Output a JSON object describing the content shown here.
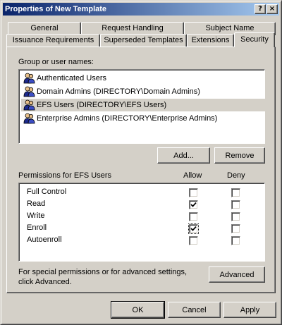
{
  "window": {
    "title": "Properties of New Template",
    "help_button": "?",
    "close_button": "×"
  },
  "tabs_back_row": [
    {
      "label": "General"
    },
    {
      "label": "Request Handling"
    },
    {
      "label": "Subject Name"
    }
  ],
  "tabs_front_row": [
    {
      "label": "Issuance Requirements"
    },
    {
      "label": "Superseded Templates"
    },
    {
      "label": "Extensions"
    },
    {
      "label": "Security",
      "active": true
    }
  ],
  "security": {
    "group_label": "Group or user names:",
    "users": [
      {
        "name": "Authenticated Users",
        "icon": "user-group-icon"
      },
      {
        "name": "Domain Admins (DIRECTORY\\Domain Admins)",
        "icon": "user-group-icon"
      },
      {
        "name": "EFS Users (DIRECTORY\\EFS Users)",
        "icon": "user-group-icon",
        "selected": true
      },
      {
        "name": "Enterprise Admins (DIRECTORY\\Enterprise Admins)",
        "icon": "user-group-icon"
      }
    ],
    "add_button": "Add...",
    "remove_button": "Remove",
    "permissions_label": "Permissions for EFS Users",
    "allow_header": "Allow",
    "deny_header": "Deny",
    "permissions": [
      {
        "name": "Full Control",
        "allow": false,
        "deny": false
      },
      {
        "name": "Read",
        "allow": true,
        "deny": false
      },
      {
        "name": "Write",
        "allow": false,
        "deny": false
      },
      {
        "name": "Enroll",
        "allow": true,
        "deny": false,
        "focused": true
      },
      {
        "name": "Autoenroll",
        "allow": false,
        "deny": false
      }
    ],
    "advanced_text_line1": "For special permissions or for advanced settings,",
    "advanced_text_line2": "click Advanced.",
    "advanced_button": "Advanced"
  },
  "footer": {
    "ok_button": "OK",
    "cancel_button": "Cancel",
    "apply_button": "Apply"
  }
}
